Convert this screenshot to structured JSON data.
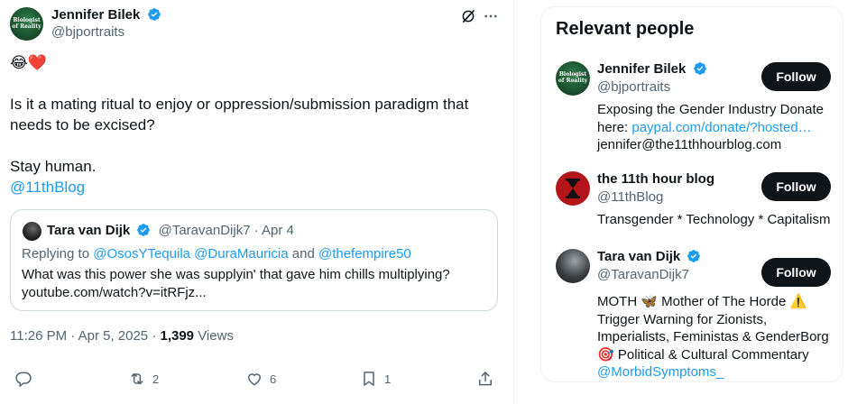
{
  "tweet": {
    "author_name": "Jennifer Bilek",
    "author_handle": "@bjportraits",
    "avatar_logo_text": "Biologist of Reality",
    "emoji_line": "😂❤️",
    "body_line1": "Is it a mating ritual to enjoy or oppression/submission paradigm that",
    "body_line2": "needs to be excised?",
    "body_line3": "Stay human.",
    "body_mention": "@11thBlog",
    "quote": {
      "name": "Tara van Dijk",
      "handle_date": "@TaravanDijk7 · Apr 4",
      "replying_prefix": "Replying to ",
      "replying_mentions": "@OsosYTequila @DuraMauricia",
      "replying_and": " and ",
      "replying_last": "@thefempire50",
      "text_line1": "What was this power she was supplyin' that gave him chills multiplying?",
      "text_line2": "youtube.com/watch?v=itRFjz..."
    },
    "timestamp": "11:26 PM · Apr 5, 2025 · ",
    "views_count": "1,399",
    "views_label": " Views",
    "actions": {
      "reply_count": "",
      "retweet_count": "2",
      "like_count": "6",
      "bookmark_count": "1"
    }
  },
  "panel": {
    "title": "Relevant people",
    "people": [
      {
        "name": "Jennifer Bilek",
        "handle": "@bjportraits",
        "bio_text": "Exposing the Gender Industry Donate here: ",
        "bio_link": "paypal.com/donate/?hosted…",
        "bio_tail": "jennifer@the11thhourblog.com",
        "follow": "Follow"
      },
      {
        "name": "the 11th hour blog",
        "handle": "@11thBlog",
        "bio_text": "Transgender * Technology * Capitalism",
        "follow": "Follow"
      },
      {
        "name": "Tara van Dijk",
        "handle": "@TaravanDijk7",
        "bio_line1": "MOTH 🦋 Mother of The Horde ⚠️",
        "bio_line2": "Trigger Warning for Zionists,",
        "bio_line3": "Imperialists, Feministas & GenderBorg",
        "bio_line4": "🎯 Political & Cultural Commentary",
        "bio_link": "@MorbidSymptoms_",
        "follow": "Follow"
      }
    ]
  },
  "colors": {
    "accent": "#1d9bf0",
    "text": "#0f1419",
    "muted": "#536471",
    "border": "#cfd9de",
    "button": "#0f1419"
  }
}
